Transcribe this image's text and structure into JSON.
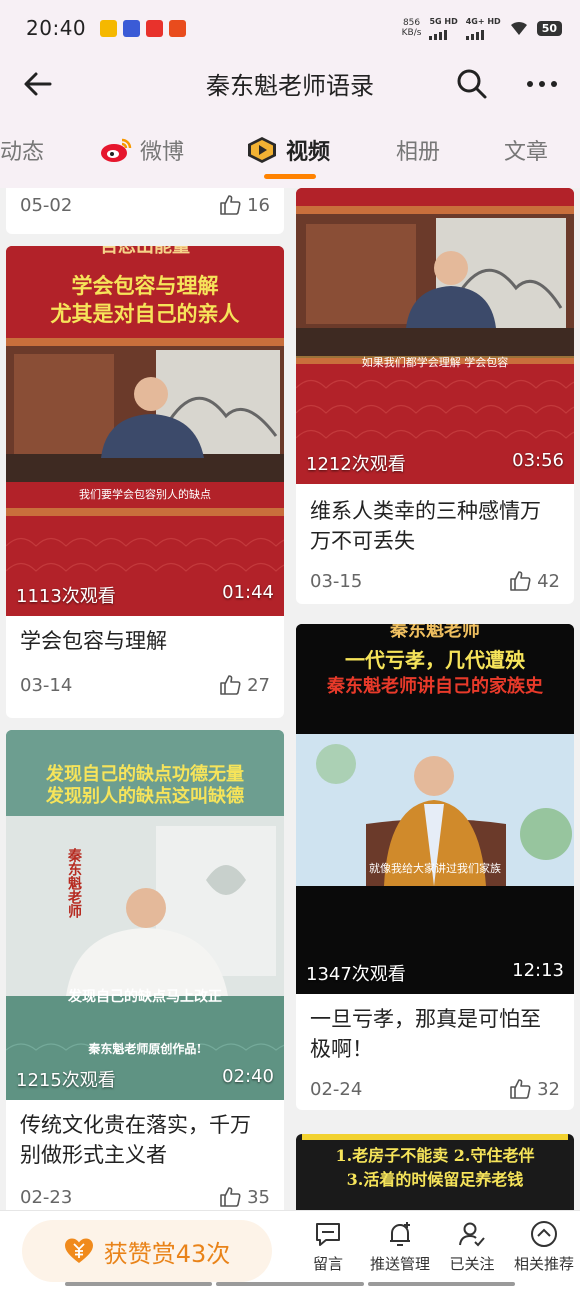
{
  "status_bar": {
    "time": "20:40",
    "net_speed_value": "856",
    "net_speed_unit": "KB/s",
    "signal1_label": "5G HD",
    "signal2_label": "4G+ HD",
    "battery": "50"
  },
  "header": {
    "title": "秦东魁老师语录"
  },
  "tabs": [
    {
      "label": "动态"
    },
    {
      "label": "微博"
    },
    {
      "label": "视频"
    },
    {
      "label": "相册"
    },
    {
      "label": "文章"
    }
  ],
  "videos": [
    {
      "date": "05-02",
      "likes": "16"
    },
    {
      "views": "1212次观看",
      "duration": "03:56",
      "title": "维系人类幸的三种感情万万不可丢失",
      "date": "03-15",
      "likes": "42",
      "subtitle": "如果我们都学会理解 学会包容"
    },
    {
      "views": "1113次观看",
      "duration": "01:44",
      "title": "学会包容与理解",
      "date": "03-14",
      "likes": "27",
      "overlay_top": "百忍出能量",
      "overlay_line1": "学会包容与理解",
      "overlay_line2": "尤其是对自己的亲人",
      "subtitle": "我们要学会包容别人的缺点"
    },
    {
      "views": "1347次观看",
      "duration": "12:13",
      "title": "一旦亏孝，那真是可怕至极啊！",
      "date": "02-24",
      "likes": "32",
      "overlay_top": "秦东魁老师",
      "overlay_line1": "一代亏孝，几代遭殃",
      "overlay_line2": "秦东魁老师讲自己的家族史",
      "subtitle": "就像我给大家讲过我们家族"
    },
    {
      "views": "1215次观看",
      "duration": "02:40",
      "title": "传统文化贵在落实，千万别做形式主义者",
      "date": "02-23",
      "likes": "35",
      "overlay_line1": "发现自己的缺点功德无量",
      "overlay_line2": "发现别人的缺点这叫缺德",
      "seal": "秦东魁老师",
      "subtitle": "发现自己的缺点马上改正",
      "banner": "秦东魁老师原创作品!"
    },
    {
      "overlay_line1": "1.老房子不能卖 2.守住老伴",
      "overlay_line2": "3.活着的时候留足养老钱"
    }
  ],
  "bottom_bar": {
    "reward_label": "获赞赏43次",
    "actions": [
      {
        "label": "留言"
      },
      {
        "label": "推送管理"
      },
      {
        "label": "已关注"
      },
      {
        "label": "相关推荐"
      }
    ]
  },
  "colors": {
    "accent": "#ff8200",
    "reward_text": "#e98319",
    "header_bg": "#f7f0f5"
  }
}
